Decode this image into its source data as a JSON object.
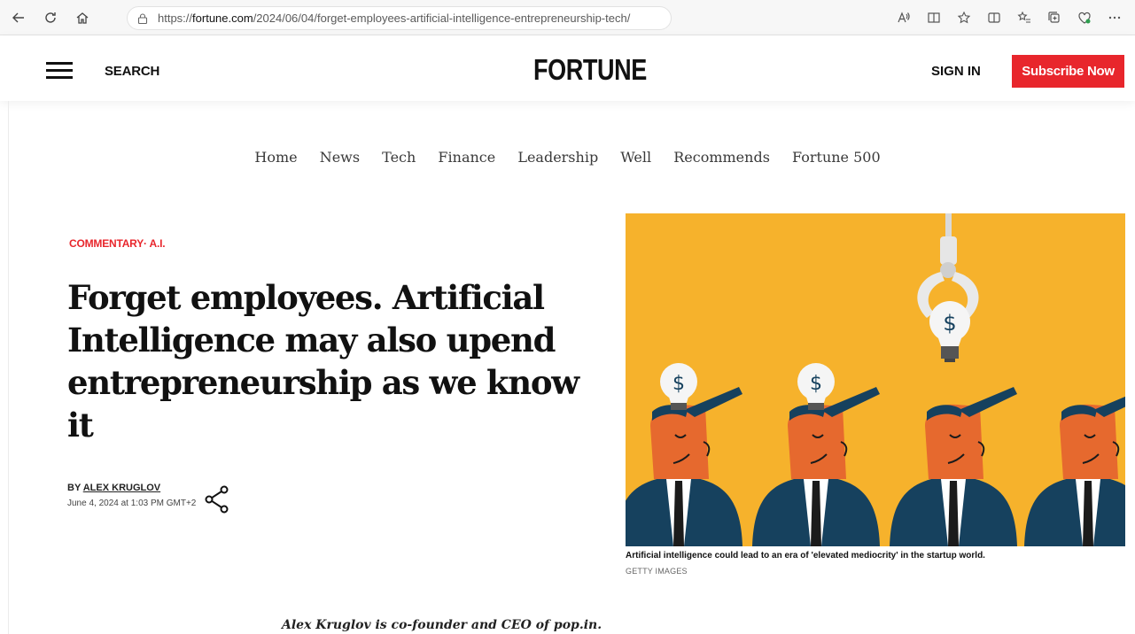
{
  "browser": {
    "url_prefix": "https://",
    "url_host": "fortune.com",
    "url_path": "/2024/06/04/forget-employees-artificial-intelligence-entrepreneurship-tech/"
  },
  "header": {
    "search_label": "SEARCH",
    "logo": "FORTUNE",
    "signin_label": "SIGN IN",
    "subscribe_label": "Subscribe Now"
  },
  "nav": {
    "items": [
      "Home",
      "News",
      "Tech",
      "Finance",
      "Leadership",
      "Well",
      "Recommends",
      "Fortune 500"
    ]
  },
  "article": {
    "kicker": "COMMENTARY· A.I.",
    "headline": "Forget employees. Artificial Intelligence may also upend entrepreneurship as we know it",
    "by_prefix": "BY ",
    "author": "ALEX KRUGLOV",
    "date": "June 4, 2024 at 1:03 PM GMT+2",
    "image_caption": "Artificial intelligence could lead to an era of 'elevated mediocrity' in the startup world.",
    "image_credit": "GETTY IMAGES",
    "dek": "Alex Kruglov is co-founder and CEO of pop.in."
  },
  "colors": {
    "accent": "#e8262c",
    "hero_background": "#f6b22c",
    "suit": "#16415e",
    "face": "#e6692e"
  }
}
